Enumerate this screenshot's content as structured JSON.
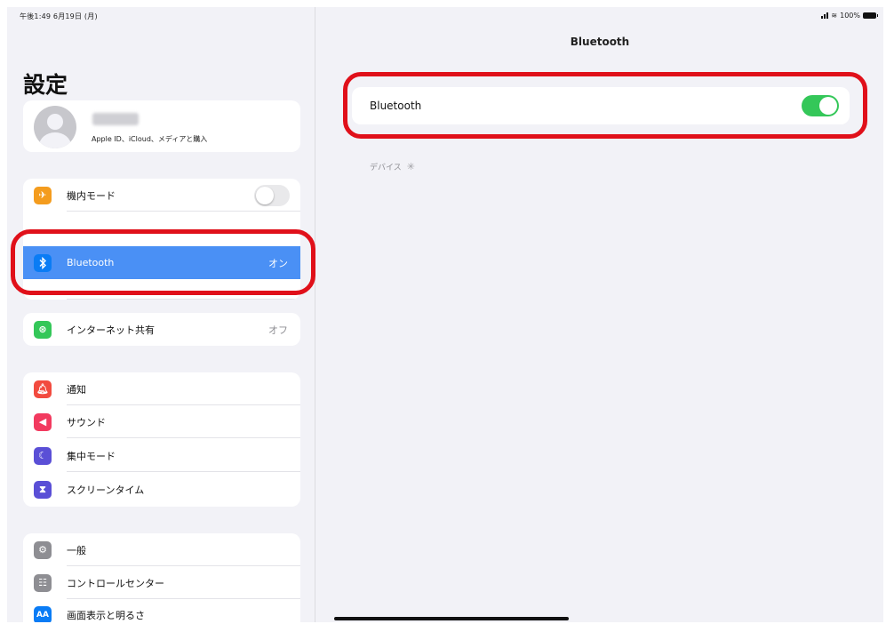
{
  "status_bar": {
    "time_date": "午後1:49  6月19日 (月)",
    "battery": "100%"
  },
  "sidebar": {
    "title": "設定",
    "profile": {
      "subtitle": "Apple ID、iCloud、メディアと購入"
    },
    "group1": [
      {
        "label": "機内モード",
        "value": "",
        "color": "#f49c1e",
        "icon": "airplane-icon"
      },
      {
        "label": "Bluetooth",
        "value": "オン",
        "color": "#0a7cf5",
        "icon": "bluetooth-icon"
      },
      {
        "label": "インターネット共有",
        "value": "オフ",
        "color": "#34c759",
        "icon": "link-icon"
      }
    ],
    "group2": [
      {
        "label": "通知",
        "color": "#f24b3f",
        "icon": "bell-icon"
      },
      {
        "label": "サウンド",
        "color": "#f23a5f",
        "icon": "speaker-icon"
      },
      {
        "label": "集中モード",
        "color": "#5a4fd6",
        "icon": "moon-icon"
      },
      {
        "label": "スクリーンタイム",
        "color": "#5a4fd6",
        "icon": "hourglass-icon"
      }
    ],
    "group3": [
      {
        "label": "一般",
        "color": "#8e8e93",
        "icon": "gear-icon"
      },
      {
        "label": "コントロールセンター",
        "color": "#8e8e93",
        "icon": "switches-icon"
      },
      {
        "label": "画面表示と明るさ",
        "color": "#0a7cf5",
        "icon": "text-size-icon"
      }
    ]
  },
  "main": {
    "nav_title": "Bluetooth",
    "bluetooth_label": "Bluetooth",
    "devices_header": "デバイス"
  },
  "colors": {
    "highlight": "#e0101a",
    "toggle_on": "#34c759",
    "selected_row": "#4a90f5"
  }
}
